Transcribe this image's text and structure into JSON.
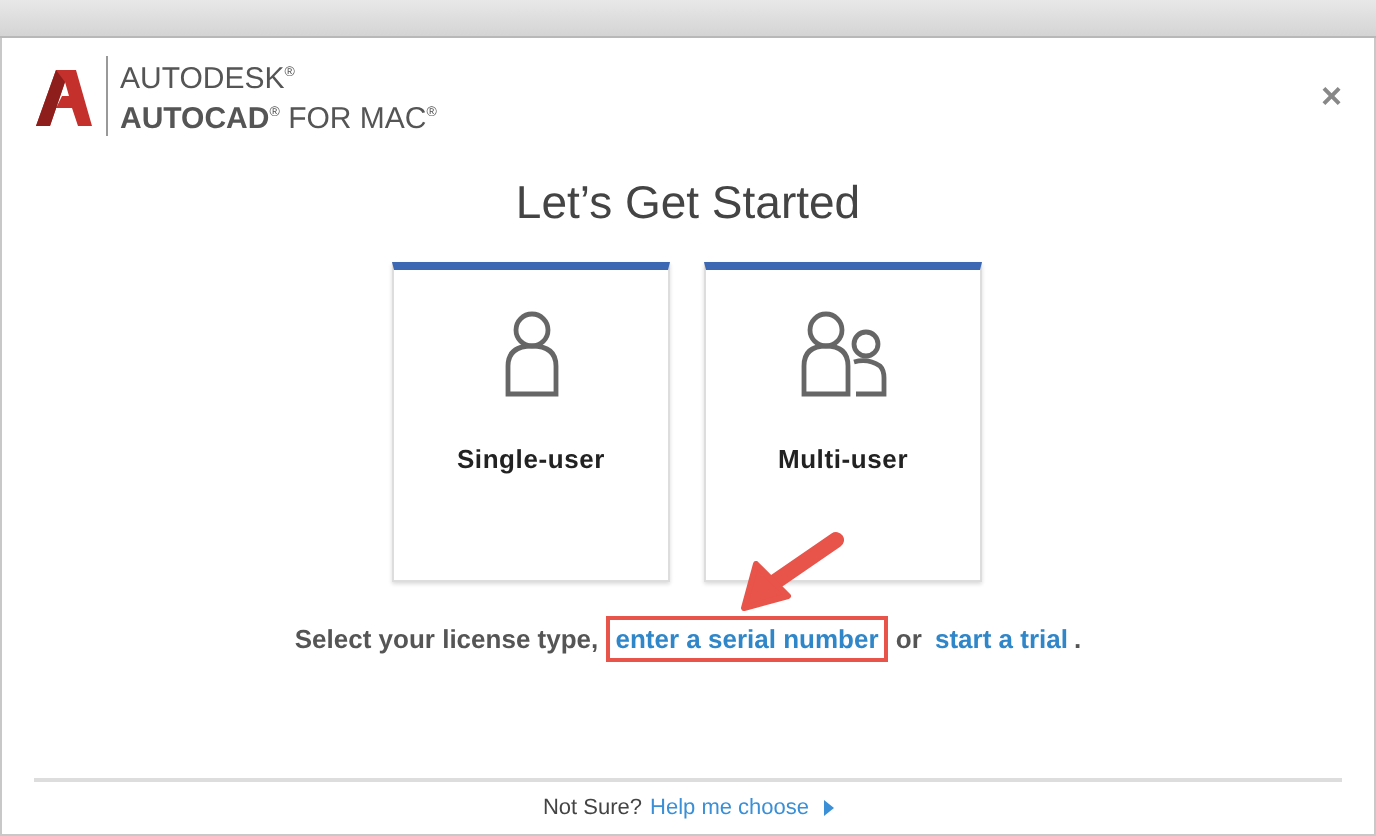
{
  "window": {
    "close": "×"
  },
  "brand": {
    "company": "AUTODESK$^{®}$",
    "product": "**AUTOCAD**$^{®}$ FOR MAC$^{®}$"
  },
  "title": "Let’s Get Started",
  "options": [
    {
      "kind": "single",
      "label": "Single-user"
    },
    {
      "kind": "multi",
      "label": "Multi-user"
    }
  ],
  "prompt": {
    "parts": [
      {
        "kind": "text",
        "text": "Select your license type,"
      },
      {
        "kind": "link",
        "text": "enter a serial number",
        "highlighted": true
      },
      {
        "kind": "text",
        "text": "or"
      },
      {
        "kind": "link",
        "text": "start a trial",
        "highlighted": false
      },
      {
        "kind": "punct",
        "text": "."
      }
    ]
  },
  "footer": {
    "text": "Not Sure?",
    "link": "Help me choose"
  }
}
